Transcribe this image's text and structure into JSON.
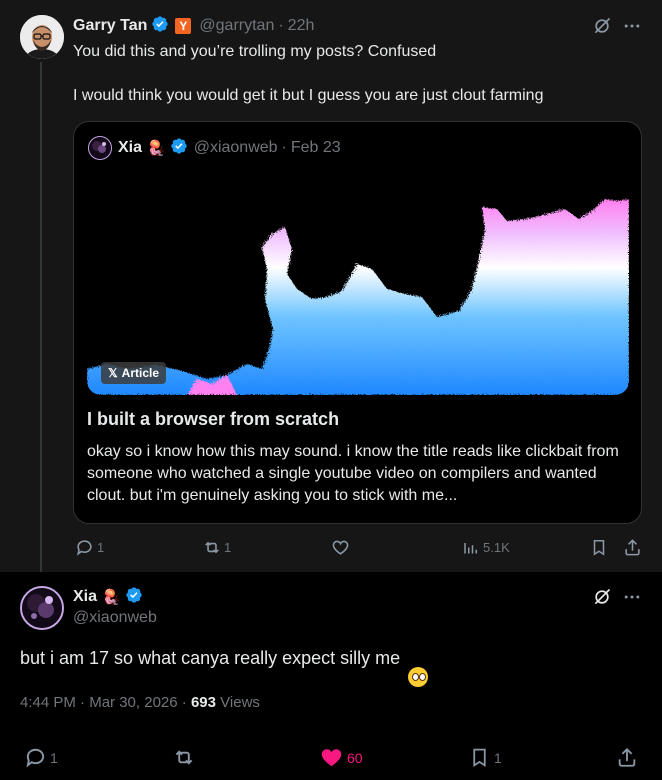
{
  "parent_tweet": {
    "author_name": "Garry Tan",
    "handle": "@garrytan",
    "separator": "·",
    "time": "22h",
    "badge_letter": "Y",
    "line1": "You did this and you’re trolling my posts? Confused",
    "line2": "I would think you would get it but I guess you are just clout farming",
    "quoted": {
      "author_name": "Xia",
      "emoji": "🪼",
      "handle": "@xiaonweb",
      "separator": "·",
      "date": "Feb 23",
      "article_badge": "Article",
      "title": "I built a browser from scratch",
      "excerpt": "okay so i know how this may sound. i know the title reads like clickbait from someone who watched a single youtube video on compilers and wanted clout. but i'm genuinely asking you to stick with me..."
    },
    "actions": {
      "replies": "1",
      "reposts": "1",
      "views": "5.1K"
    }
  },
  "main_tweet": {
    "author_name": "Xia",
    "emoji": "🪼",
    "handle": "@xiaonweb",
    "text": "but i am 17 so what canya really expect silly me",
    "text_emoji": "🥺",
    "time": "4:44 PM",
    "separator": "·",
    "date": "Mar 30, 2026",
    "separator2": "·",
    "views_count": "693",
    "views_label": "Views",
    "actions": {
      "replies": "1",
      "likes": "60",
      "bookmarks": "1"
    }
  },
  "colors": {
    "background": "#000000",
    "text": "#e7e9ea",
    "muted": "#71767b",
    "verified": "#1d9bf0",
    "like": "#f91880",
    "yc": "#f26522",
    "border": "#2f3336"
  }
}
